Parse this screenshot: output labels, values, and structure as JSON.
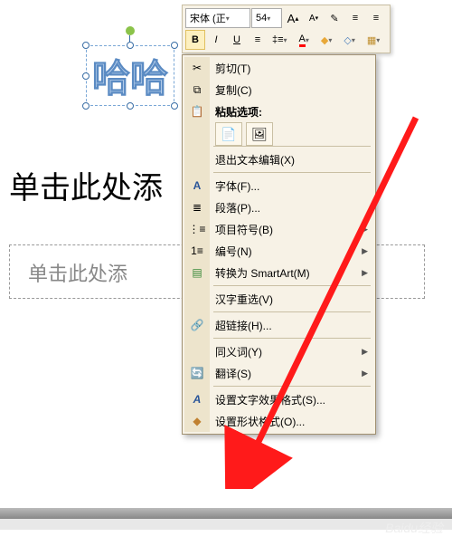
{
  "wordart": {
    "text": "哈哈"
  },
  "placeholders": {
    "title": "单击此处添",
    "subtitle": "单击此处添"
  },
  "mini_toolbar": {
    "font_name": "宋体 (正",
    "font_size": "54",
    "grow": "A",
    "shrink": "A",
    "bold": "B",
    "italic": "I",
    "underline": "U"
  },
  "context_menu": {
    "cut": "剪切(T)",
    "copy": "复制(C)",
    "paste_options": "粘贴选项:",
    "exit_text_edit": "退出文本编辑(X)",
    "font": "字体(F)...",
    "paragraph": "段落(P)...",
    "bullets": "项目符号(B)",
    "numbering": "编号(N)",
    "smartart": "转换为 SmartArt(M)",
    "chinese_reselect": "汉字重选(V)",
    "hyperlink": "超链接(H)...",
    "synonyms": "同义词(Y)",
    "translate": "翻译(S)",
    "text_effects": "设置文字效果格式(S)...",
    "shape_format": "设置形状格式(O)..."
  },
  "watermark": "Baidu经验"
}
